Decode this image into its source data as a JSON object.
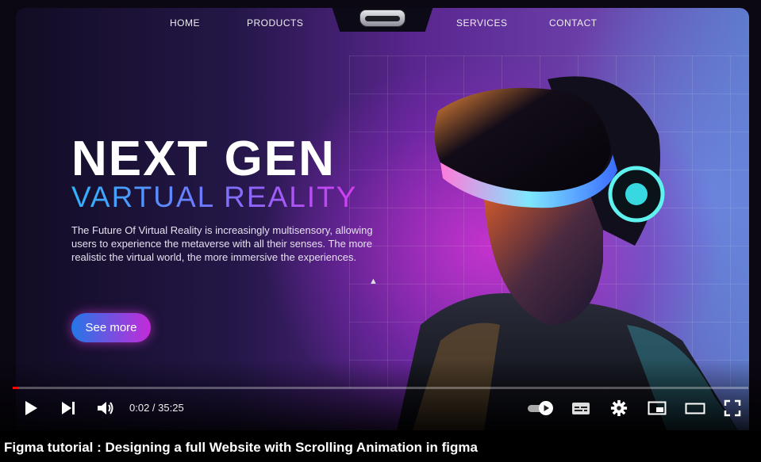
{
  "nav": {
    "items": [
      "HOME",
      "PRODUCTS",
      "SERVICES",
      "CONTACT"
    ]
  },
  "hero": {
    "title": "NEXT GEN",
    "subtitle": "VARTUAL REALITY",
    "description": "The Future Of Virtual Reality is increasingly multisensory, allowing users to experience the metaverse with all their senses. The more realistic the virtual world, the more immersive the experiences.",
    "cta_label": "See more"
  },
  "player": {
    "time": "0:02 / 35:25",
    "progress": 0.001,
    "controls": {
      "play": "play-icon",
      "next": "next-icon",
      "volume": "volume-icon",
      "autoplay": "autoplay-toggle-icon",
      "subtitles": "subtitles-icon",
      "settings": "gear-icon",
      "miniplayer": "miniplayer-icon",
      "theater": "theater-icon",
      "fullscreen": "fullscreen-icon"
    }
  },
  "video": {
    "title": "Figma tutorial : Designing a full Website with Scrolling Animation in figma"
  },
  "colors": {
    "accent_blue": "#2fb4ff",
    "accent_magenta": "#d43cf0",
    "progress_red": "#ff0000"
  }
}
